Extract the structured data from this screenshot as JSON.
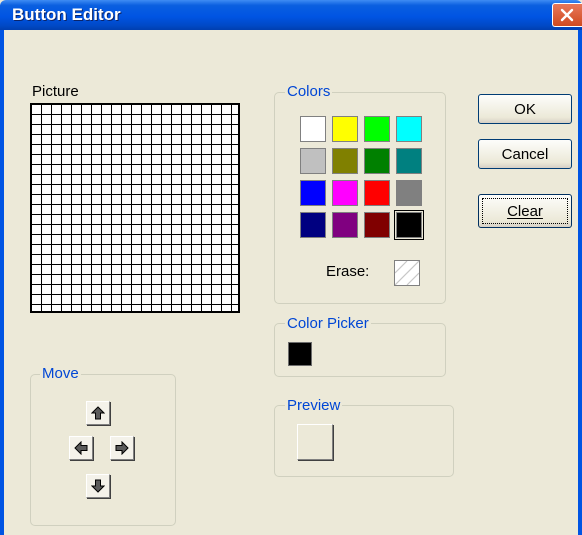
{
  "window": {
    "title": "Button Editor",
    "close_icon": "close-icon"
  },
  "picture": {
    "label": "Picture"
  },
  "colors": {
    "label": "Colors",
    "swatches": [
      "#ffffff",
      "#ffff00",
      "#00ff00",
      "#00ffff",
      "#c0c0c0",
      "#808000",
      "#008000",
      "#008080",
      "#0000ff",
      "#ff00ff",
      "#ff0000",
      "#808080",
      "#000080",
      "#800080",
      "#800000",
      "#000000"
    ],
    "selected_color": "#000000",
    "erase_label": "Erase:"
  },
  "color_picker": {
    "label": "Color Picker",
    "current_color": "#000000"
  },
  "preview": {
    "label": "Preview"
  },
  "move": {
    "label": "Move",
    "up_icon": "arrow-up-icon",
    "left_icon": "arrow-left-icon",
    "right_icon": "arrow-right-icon",
    "down_icon": "arrow-down-icon"
  },
  "buttons": {
    "ok": "OK",
    "cancel": "Cancel",
    "clear": "Clear"
  }
}
